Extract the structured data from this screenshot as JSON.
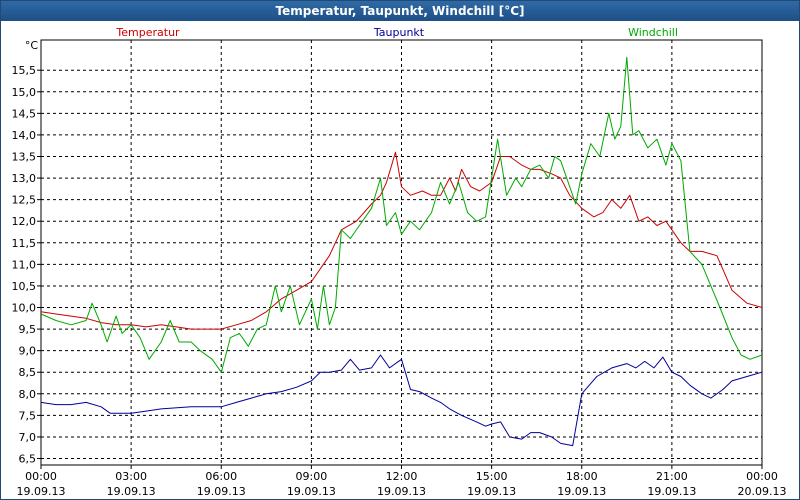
{
  "window": {
    "title": "Temperatur, Taupunkt, Windchill [°C]"
  },
  "chart_data": {
    "type": "line",
    "title": "Temperatur, Taupunkt, Windchill [°C]",
    "ylabel": "°C",
    "ylim": [
      6.35,
      16.2
    ],
    "xlim": [
      0,
      24
    ],
    "grid": true,
    "legend": "top",
    "y_ticks": [
      "6,5",
      "7,0",
      "7,5",
      "8,0",
      "8,5",
      "9,0",
      "9,5",
      "10,0",
      "10,5",
      "11,0",
      "11,5",
      "12,0",
      "12,5",
      "13,0",
      "13,5",
      "14,0",
      "14,5",
      "15,0",
      "15,5"
    ],
    "x_ticks": [
      {
        "time": "00:00",
        "date": "19.09.13"
      },
      {
        "time": "03:00",
        "date": "19.09.13"
      },
      {
        "time": "06:00",
        "date": "19.09.13"
      },
      {
        "time": "09:00",
        "date": "19.09.13"
      },
      {
        "time": "12:00",
        "date": "19.09.13"
      },
      {
        "time": "15:00",
        "date": "19.09.13"
      },
      {
        "time": "18:00",
        "date": "19.09.13"
      },
      {
        "time": "21:00",
        "date": "19.09.13"
      },
      {
        "time": "00:00",
        "date": "20.09.13"
      }
    ],
    "series": [
      {
        "name": "Temperatur",
        "color": "#cc0000",
        "points": [
          [
            0,
            9.9
          ],
          [
            0.5,
            9.85
          ],
          [
            1,
            9.8
          ],
          [
            1.5,
            9.75
          ],
          [
            2,
            9.65
          ],
          [
            2.5,
            9.6
          ],
          [
            3,
            9.6
          ],
          [
            3.5,
            9.55
          ],
          [
            4,
            9.6
          ],
          [
            4.5,
            9.55
          ],
          [
            5,
            9.5
          ],
          [
            5.5,
            9.5
          ],
          [
            6,
            9.5
          ],
          [
            6.5,
            9.6
          ],
          [
            7,
            9.7
          ],
          [
            7.5,
            9.9
          ],
          [
            8,
            10.2
          ],
          [
            8.5,
            10.4
          ],
          [
            9,
            10.6
          ],
          [
            9.3,
            10.9
          ],
          [
            9.6,
            11.2
          ],
          [
            10,
            11.8
          ],
          [
            10.5,
            12.0
          ],
          [
            11,
            12.4
          ],
          [
            11.3,
            12.6
          ],
          [
            11.5,
            12.9
          ],
          [
            11.8,
            13.6
          ],
          [
            12,
            12.8
          ],
          [
            12.3,
            12.6
          ],
          [
            12.7,
            12.7
          ],
          [
            13,
            12.6
          ],
          [
            13.3,
            12.6
          ],
          [
            13.6,
            13.0
          ],
          [
            13.8,
            12.7
          ],
          [
            14,
            13.2
          ],
          [
            14.3,
            12.8
          ],
          [
            14.6,
            12.7
          ],
          [
            15,
            12.9
          ],
          [
            15.3,
            13.5
          ],
          [
            15.6,
            13.5
          ],
          [
            16,
            13.3
          ],
          [
            16.3,
            13.2
          ],
          [
            16.6,
            13.2
          ],
          [
            17,
            13.1
          ],
          [
            17.3,
            13.0
          ],
          [
            17.6,
            12.6
          ],
          [
            18,
            12.3
          ],
          [
            18.4,
            12.1
          ],
          [
            18.7,
            12.2
          ],
          [
            19,
            12.5
          ],
          [
            19.3,
            12.3
          ],
          [
            19.6,
            12.6
          ],
          [
            19.9,
            12.0
          ],
          [
            20.2,
            12.1
          ],
          [
            20.5,
            11.9
          ],
          [
            20.8,
            12.0
          ],
          [
            21,
            11.8
          ],
          [
            21.3,
            11.5
          ],
          [
            21.6,
            11.3
          ],
          [
            22,
            11.3
          ],
          [
            22.5,
            11.2
          ],
          [
            23,
            10.4
          ],
          [
            23.5,
            10.1
          ],
          [
            24,
            10.0
          ]
        ]
      },
      {
        "name": "Taupunkt",
        "color": "#000099",
        "points": [
          [
            0,
            7.8
          ],
          [
            0.5,
            7.75
          ],
          [
            1,
            7.75
          ],
          [
            1.5,
            7.8
          ],
          [
            2,
            7.7
          ],
          [
            2.3,
            7.55
          ],
          [
            3,
            7.55
          ],
          [
            3.5,
            7.6
          ],
          [
            4,
            7.65
          ],
          [
            5,
            7.7
          ],
          [
            6,
            7.7
          ],
          [
            6.5,
            7.8
          ],
          [
            7,
            7.9
          ],
          [
            7.5,
            8.0
          ],
          [
            8,
            8.05
          ],
          [
            8.5,
            8.15
          ],
          [
            9,
            8.3
          ],
          [
            9.3,
            8.5
          ],
          [
            9.6,
            8.5
          ],
          [
            10,
            8.55
          ],
          [
            10.3,
            8.8
          ],
          [
            10.6,
            8.55
          ],
          [
            11,
            8.6
          ],
          [
            11.3,
            8.9
          ],
          [
            11.6,
            8.6
          ],
          [
            12,
            8.8
          ],
          [
            12.3,
            8.1
          ],
          [
            12.6,
            8.05
          ],
          [
            13,
            7.9
          ],
          [
            13.3,
            7.8
          ],
          [
            13.6,
            7.65
          ],
          [
            14,
            7.5
          ],
          [
            14.5,
            7.35
          ],
          [
            14.8,
            7.25
          ],
          [
            15,
            7.3
          ],
          [
            15.3,
            7.35
          ],
          [
            15.6,
            7.0
          ],
          [
            16,
            6.95
          ],
          [
            16.3,
            7.1
          ],
          [
            16.6,
            7.1
          ],
          [
            17,
            7.0
          ],
          [
            17.3,
            6.85
          ],
          [
            17.7,
            6.8
          ],
          [
            18,
            8.0
          ],
          [
            18.5,
            8.4
          ],
          [
            19,
            8.6
          ],
          [
            19.5,
            8.7
          ],
          [
            19.8,
            8.6
          ],
          [
            20.1,
            8.75
          ],
          [
            20.4,
            8.6
          ],
          [
            20.7,
            8.85
          ],
          [
            21,
            8.5
          ],
          [
            21.3,
            8.4
          ],
          [
            21.6,
            8.2
          ],
          [
            22,
            8.0
          ],
          [
            22.3,
            7.9
          ],
          [
            22.7,
            8.1
          ],
          [
            23,
            8.3
          ],
          [
            23.5,
            8.4
          ],
          [
            24,
            8.5
          ]
        ]
      },
      {
        "name": "Windchill",
        "color": "#00aa00",
        "points": [
          [
            0,
            9.85
          ],
          [
            0.5,
            9.7
          ],
          [
            1,
            9.6
          ],
          [
            1.5,
            9.7
          ],
          [
            1.7,
            10.1
          ],
          [
            2,
            9.6
          ],
          [
            2.2,
            9.2
          ],
          [
            2.5,
            9.8
          ],
          [
            2.7,
            9.4
          ],
          [
            3,
            9.6
          ],
          [
            3.3,
            9.3
          ],
          [
            3.6,
            8.8
          ],
          [
            4,
            9.2
          ],
          [
            4.3,
            9.7
          ],
          [
            4.6,
            9.2
          ],
          [
            5,
            9.2
          ],
          [
            5.3,
            9.0
          ],
          [
            5.7,
            8.8
          ],
          [
            6,
            8.5
          ],
          [
            6.3,
            9.3
          ],
          [
            6.6,
            9.4
          ],
          [
            6.9,
            9.1
          ],
          [
            7.2,
            9.5
          ],
          [
            7.5,
            9.6
          ],
          [
            7.8,
            10.5
          ],
          [
            8,
            9.9
          ],
          [
            8.3,
            10.5
          ],
          [
            8.6,
            9.6
          ],
          [
            9,
            10.2
          ],
          [
            9.2,
            9.5
          ],
          [
            9.4,
            10.5
          ],
          [
            9.6,
            9.6
          ],
          [
            9.8,
            10.0
          ],
          [
            10,
            11.8
          ],
          [
            10.3,
            11.6
          ],
          [
            10.6,
            11.9
          ],
          [
            11,
            12.3
          ],
          [
            11.3,
            13.0
          ],
          [
            11.5,
            11.9
          ],
          [
            11.8,
            12.2
          ],
          [
            12,
            11.7
          ],
          [
            12.3,
            12.0
          ],
          [
            12.6,
            11.8
          ],
          [
            13,
            12.2
          ],
          [
            13.3,
            12.9
          ],
          [
            13.6,
            12.4
          ],
          [
            13.9,
            12.9
          ],
          [
            14.2,
            12.2
          ],
          [
            14.5,
            12.0
          ],
          [
            14.8,
            12.1
          ],
          [
            15,
            13.0
          ],
          [
            15.2,
            13.9
          ],
          [
            15.5,
            12.6
          ],
          [
            15.8,
            13.0
          ],
          [
            16,
            12.8
          ],
          [
            16.3,
            13.2
          ],
          [
            16.6,
            13.3
          ],
          [
            16.9,
            13.0
          ],
          [
            17.1,
            13.5
          ],
          [
            17.3,
            13.4
          ],
          [
            17.6,
            12.8
          ],
          [
            17.8,
            12.4
          ],
          [
            18,
            13.1
          ],
          [
            18.3,
            13.8
          ],
          [
            18.6,
            13.5
          ],
          [
            18.9,
            14.5
          ],
          [
            19.1,
            13.9
          ],
          [
            19.3,
            14.2
          ],
          [
            19.5,
            15.8
          ],
          [
            19.7,
            14.0
          ],
          [
            19.9,
            14.1
          ],
          [
            20.2,
            13.7
          ],
          [
            20.5,
            13.9
          ],
          [
            20.8,
            13.3
          ],
          [
            21,
            13.8
          ],
          [
            21.3,
            13.4
          ],
          [
            21.6,
            11.3
          ],
          [
            22,
            11.0
          ],
          [
            22.3,
            10.5
          ],
          [
            22.6,
            10.0
          ],
          [
            23,
            9.3
          ],
          [
            23.3,
            8.9
          ],
          [
            23.6,
            8.8
          ],
          [
            24,
            8.9
          ]
        ]
      }
    ]
  }
}
